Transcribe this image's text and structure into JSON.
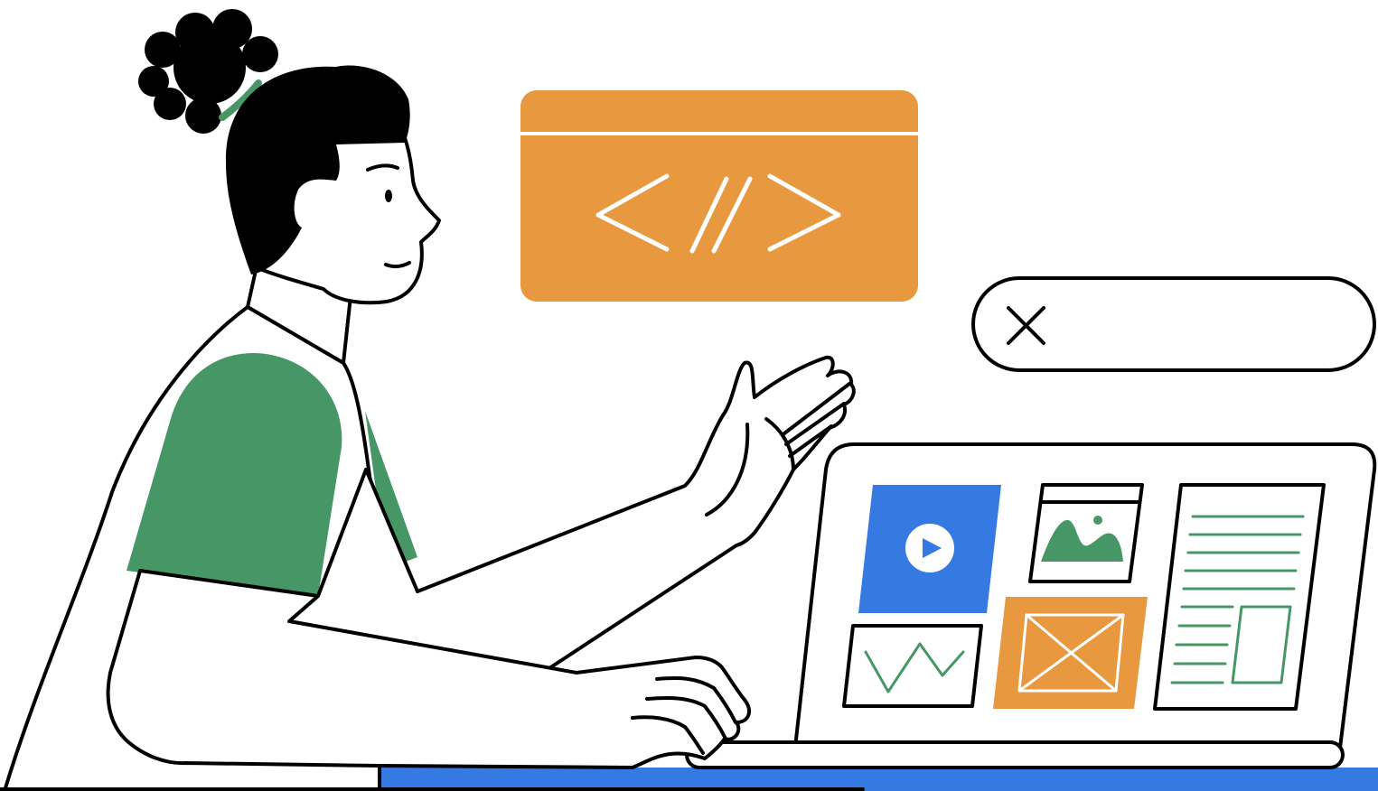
{
  "illustration": {
    "subject": "person-at-laptop",
    "code_card_glyph": "</>",
    "search_icon": "close-icon",
    "laptop_tiles": [
      "play-video-icon",
      "image-landscape-icon",
      "text-document-icon",
      "line-chart-icon",
      "image-placeholder-icon"
    ]
  },
  "colors": {
    "orange": "#E8993F",
    "green": "#469765",
    "blue": "#3579E3",
    "outline": "#000000",
    "background": "#FFFFFF"
  }
}
